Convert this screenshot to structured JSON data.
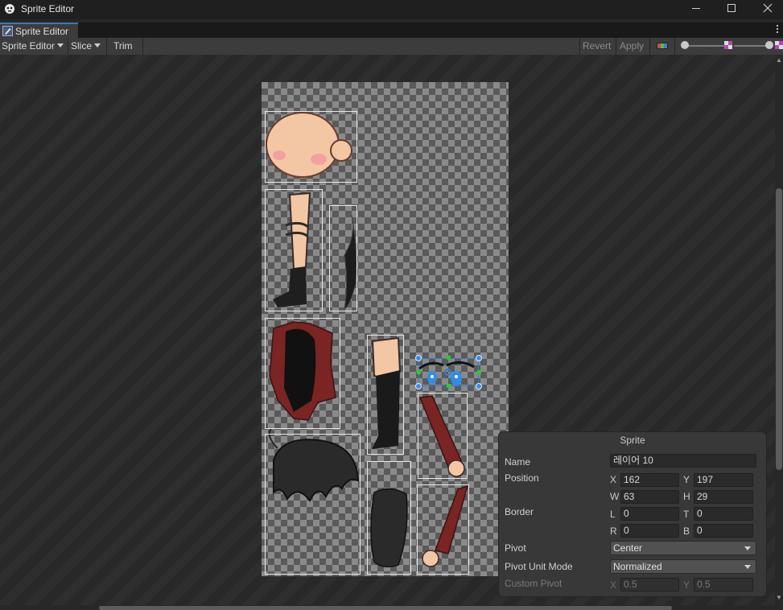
{
  "window": {
    "title": "Sprite Editor"
  },
  "tab": {
    "label": "Sprite Editor"
  },
  "toolbar": {
    "editor_mode": "Sprite Editor",
    "slice": "Slice",
    "trim": "Trim",
    "revert": "Revert",
    "apply": "Apply"
  },
  "sprite_panel": {
    "title": "Sprite",
    "name_label": "Name",
    "name_value": "레이어 10",
    "position_label": "Position",
    "x_label": "X",
    "x_value": "162",
    "y_label": "Y",
    "y_value": "197",
    "w_label": "W",
    "w_value": "63",
    "h_label": "H",
    "h_value": "29",
    "border_label": "Border",
    "l_label": "L",
    "l_value": "0",
    "t_label": "T",
    "t_value": "0",
    "r_label": "R",
    "r_value": "0",
    "b_label": "B",
    "b_value": "0",
    "pivot_label": "Pivot",
    "pivot_value": "Center",
    "pivot_unit_label": "Pivot Unit Mode",
    "pivot_unit_value": "Normalized",
    "custom_pivot_label": "Custom Pivot",
    "cx_label": "X",
    "cx_value": "0.5",
    "cy_label": "Y",
    "cy_value": "0.5"
  }
}
